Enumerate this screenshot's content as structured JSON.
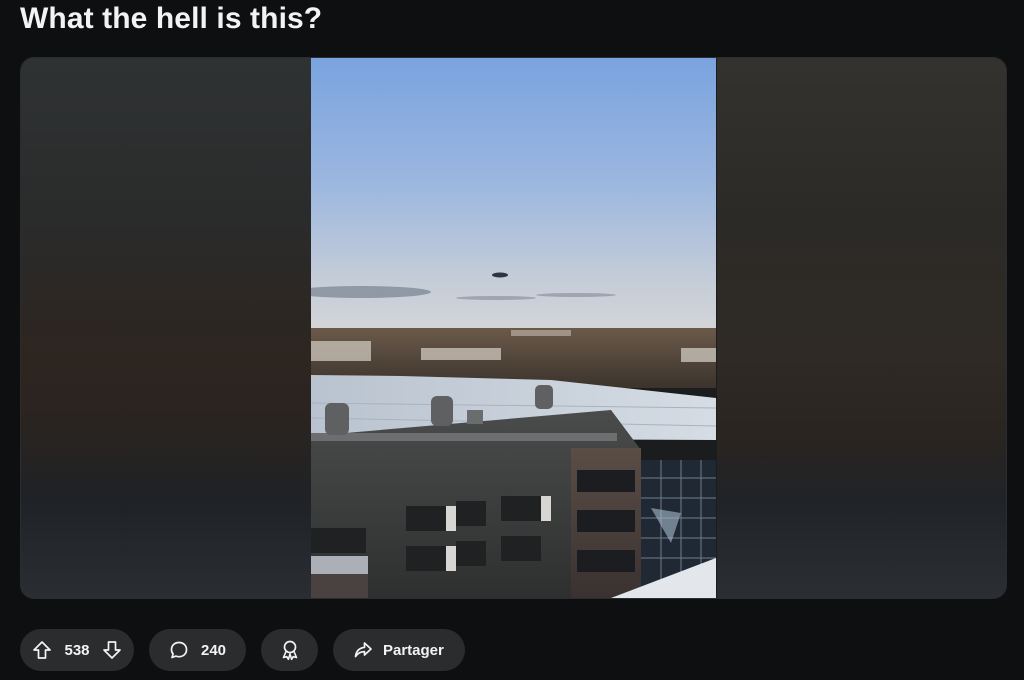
{
  "post": {
    "title": "What the hell is this?"
  },
  "actions": {
    "vote_count": "538",
    "comment_count": "240",
    "share_label": "Partager"
  },
  "icons": {
    "upvote": "arrow-up-icon",
    "downvote": "arrow-down-icon",
    "comments": "speech-bubble-icon",
    "award": "award-ribbon-icon",
    "share": "share-arrow-icon"
  },
  "colors": {
    "page_background": "#0e0f10",
    "pill_background": "#2a2c2e",
    "text": "#f2f3f5",
    "sky_top": "#7ea6e0",
    "sky_horizon": "#c7cfd8"
  }
}
